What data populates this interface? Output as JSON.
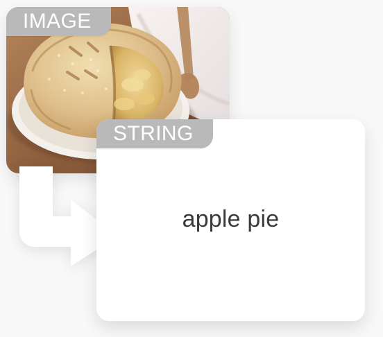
{
  "image_card": {
    "tag_label": "IMAGE",
    "picture": "apple pie in a white dish with a slice cut out"
  },
  "string_card": {
    "tag_label": "STRING",
    "value": "apple pie"
  },
  "colors": {
    "background": "#f9f9f9",
    "card": "#ffffff",
    "tag": "#b9b9b9",
    "tag_text": "#ffffff",
    "value_text": "#3a3a3a"
  }
}
